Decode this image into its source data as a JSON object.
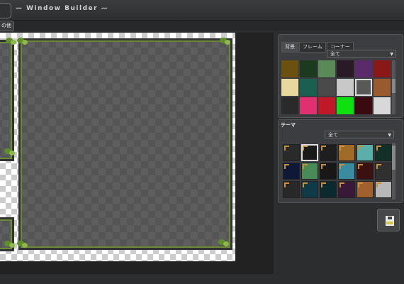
{
  "app": {
    "title": "— Window Builder —"
  },
  "toolbar": {
    "button_label": "の他"
  },
  "background_panel": {
    "tabs": [
      "背景",
      "フレーム",
      "コーナー"
    ],
    "active_tab": 0,
    "filter": "全て",
    "swatches": [
      "#6b5010",
      "#1c3a20",
      "#5a8a58",
      "#2a1a28",
      "#5a2a6a",
      "#8a1818",
      "#e8d8a0",
      "#1a6050",
      "#4a4a4a",
      "#c8c8c8",
      "#585858",
      "#9a5a30",
      "#2a2a2a",
      "#e03070",
      "#c01828",
      "#10e010",
      "#3a0a10",
      "#d8d8d8"
    ],
    "selected_swatch": 10
  },
  "theme_panel": {
    "title": "テーマ",
    "filter": "全て",
    "themes": [
      "#2a2a2a",
      "#1a1a1a",
      "#1e1e1e",
      "#a06a28",
      "#5ab0a8",
      "#123028",
      "#101838",
      "#4a8a58",
      "#181818",
      "#3a8aa0",
      "#3a1010",
      "#303030",
      "#282828",
      "#103a48",
      "#0a2a30",
      "#3a1838",
      "#a06030",
      "#b8b8b8"
    ],
    "selected_theme": 1
  }
}
